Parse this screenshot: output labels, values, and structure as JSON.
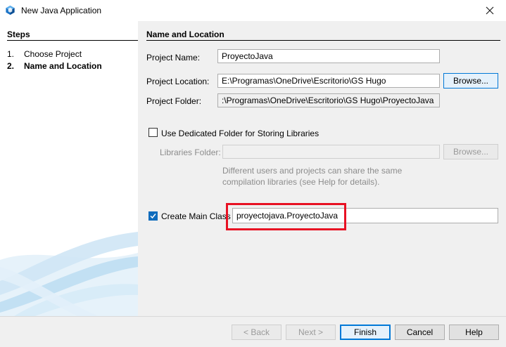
{
  "window": {
    "title": "New Java Application"
  },
  "steps": {
    "title": "Steps",
    "items": [
      {
        "num": "1.",
        "label": "Choose Project"
      },
      {
        "num": "2.",
        "label": "Name and Location"
      }
    ]
  },
  "form": {
    "section_title": "Name and Location",
    "project_name_label": "Project Name:",
    "project_name_value": "ProyectoJava",
    "project_location_label": "Project Location:",
    "project_location_value": "E:\\Programas\\OneDrive\\Escritorio\\GS Hugo",
    "browse_label": "Browse...",
    "project_folder_label": "Project Folder:",
    "project_folder_value": ":\\Programas\\OneDrive\\Escritorio\\GS Hugo\\ProyectoJava",
    "dedicated_folder_label": "Use Dedicated Folder for Storing Libraries",
    "dedicated_folder_checked": false,
    "libraries_folder_label": "Libraries Folder:",
    "libraries_folder_value": "",
    "libraries_browse_label": "Browse...",
    "hint_line1": "Different users and projects can share the same",
    "hint_line2": "compilation libraries (see Help for details).",
    "main_class_label": "Create Main Class",
    "main_class_checked": true,
    "main_class_value": "proyectojava.ProyectoJava"
  },
  "footer": {
    "back_label": "< Back",
    "next_label": "Next >",
    "finish_label": "Finish",
    "cancel_label": "Cancel",
    "help_label": "Help"
  },
  "colors": {
    "highlight": "#e81123",
    "accent": "#0078d7",
    "checkbox": "#0f6cbd"
  },
  "icons": {
    "app": "netbeans-cube-icon",
    "close": "close-icon",
    "check": "checkmark-icon"
  }
}
